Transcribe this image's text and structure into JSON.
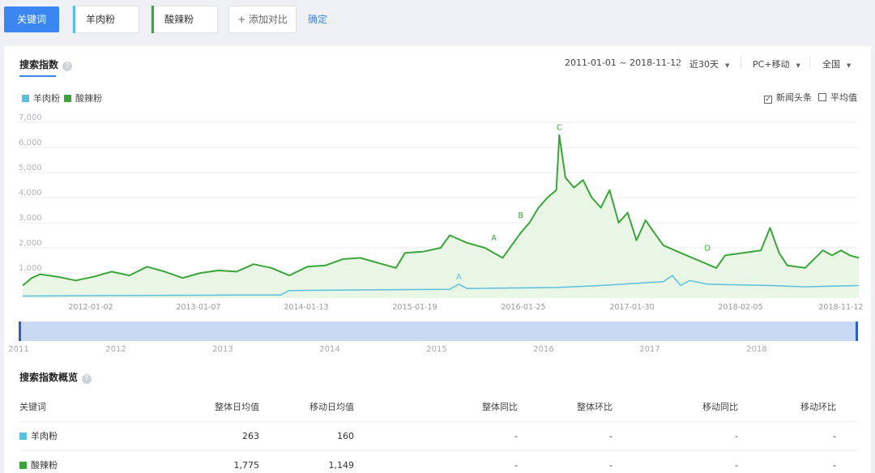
{
  "keywords_bar": {
    "keyword_button": "关键词",
    "chips": [
      {
        "label": "羊肉粉",
        "color": "#5bc0de"
      },
      {
        "label": "酸辣粉",
        "color": "#3aa53a"
      }
    ],
    "add_compare": "+ 添加对比",
    "confirm": "确定"
  },
  "section": {
    "title": "搜索指数",
    "date_range": "2011-01-01 ~ 2018-11-12",
    "period": "近30天",
    "device": "PC+移动",
    "region": "全国"
  },
  "legend": [
    {
      "label": "羊肉粉",
      "color": "#5bc0de"
    },
    {
      "label": "酸辣粉",
      "color": "#3aa53a"
    }
  ],
  "options": {
    "news_label": "新闻头条",
    "news_checked": true,
    "avg_label": "平均值",
    "avg_checked": false
  },
  "chart_data": {
    "type": "line",
    "ylim": [
      0,
      7000
    ],
    "yticks": [
      "7,000",
      "6,000",
      "5,000",
      "4,000",
      "3,000",
      "2,000",
      "1,000"
    ],
    "x_tick_labels": [
      "2012-01-02",
      "2013-01-07",
      "2014-01-13",
      "2015-01-19",
      "2016-01-25",
      "2017-01-30",
      "2018-02-05",
      "2018-11-12"
    ],
    "grid": true,
    "series": [
      {
        "name": "酸辣粉",
        "color": "#3aa53a",
        "points": [
          [
            "2011-01",
            500
          ],
          [
            "2011-02",
            800
          ],
          [
            "2011-03",
            950
          ],
          [
            "2011-05",
            850
          ],
          [
            "2011-07",
            700
          ],
          [
            "2011-09",
            850
          ],
          [
            "2011-11",
            1050
          ],
          [
            "2012-01",
            900
          ],
          [
            "2012-03",
            1250
          ],
          [
            "2012-05",
            1050
          ],
          [
            "2012-07",
            800
          ],
          [
            "2012-09",
            1000
          ],
          [
            "2012-11",
            1100
          ],
          [
            "2013-01",
            1050
          ],
          [
            "2013-03",
            1350
          ],
          [
            "2013-05",
            1200
          ],
          [
            "2013-07",
            900
          ],
          [
            "2013-09",
            1250
          ],
          [
            "2013-11",
            1300
          ],
          [
            "2014-01",
            1550
          ],
          [
            "2014-03",
            1600
          ],
          [
            "2014-05",
            1400
          ],
          [
            "2014-07",
            1200
          ],
          [
            "2014-08",
            1800
          ],
          [
            "2014-10",
            1850
          ],
          [
            "2014-12",
            2000
          ],
          [
            "2015-01",
            2500
          ],
          [
            "2015-03",
            2200
          ],
          [
            "2015-05",
            2000
          ],
          [
            "2015-07",
            1600
          ],
          [
            "2015-08",
            2100
          ],
          [
            "2015-09",
            2600
          ],
          [
            "2015-10",
            3000
          ],
          [
            "2015-11",
            3600
          ],
          [
            "2015-12",
            4000
          ],
          [
            "2016-01",
            4300
          ],
          [
            "2016-01-25",
            6500
          ],
          [
            "2016-02",
            4800
          ],
          [
            "2016-03",
            4400
          ],
          [
            "2016-04",
            4700
          ],
          [
            "2016-05",
            4000
          ],
          [
            "2016-06",
            3600
          ],
          [
            "2016-07",
            4300
          ],
          [
            "2016-08",
            3000
          ],
          [
            "2016-09",
            3400
          ],
          [
            "2016-10",
            2300
          ],
          [
            "2016-11",
            3100
          ],
          [
            "2016-12",
            2600
          ],
          [
            "2017-01",
            2100
          ],
          [
            "2017-03",
            1800
          ],
          [
            "2017-05",
            1500
          ],
          [
            "2017-07",
            1200
          ],
          [
            "2017-08",
            1700
          ],
          [
            "2017-10",
            1800
          ],
          [
            "2017-12",
            1900
          ],
          [
            "2018-01",
            2800
          ],
          [
            "2018-02",
            1800
          ],
          [
            "2018-03",
            1300
          ],
          [
            "2018-05",
            1200
          ],
          [
            "2018-07",
            1900
          ],
          [
            "2018-08",
            1700
          ],
          [
            "2018-09",
            1900
          ],
          [
            "2018-10",
            1700
          ],
          [
            "2018-11",
            1600
          ]
        ]
      },
      {
        "name": "羊肉粉",
        "color": "#5bc0de",
        "points": [
          [
            "2011-01",
            80
          ],
          [
            "2012-01",
            100
          ],
          [
            "2013-01",
            120
          ],
          [
            "2013-06",
            120
          ],
          [
            "2013-07",
            300
          ],
          [
            "2014-01",
            320
          ],
          [
            "2015-01",
            350
          ],
          [
            "2015-02",
            550
          ],
          [
            "2015-03",
            380
          ],
          [
            "2016-01",
            420
          ],
          [
            "2016-06",
            500
          ],
          [
            "2017-01",
            650
          ],
          [
            "2017-02",
            900
          ],
          [
            "2017-03",
            500
          ],
          [
            "2017-04",
            700
          ],
          [
            "2017-06",
            550
          ],
          [
            "2018-01",
            500
          ],
          [
            "2018-05",
            450
          ],
          [
            "2018-11",
            500
          ]
        ]
      }
    ],
    "annotations": [
      {
        "label": "A",
        "series": "酸辣粉",
        "x": "2015-06",
        "y": 2100
      },
      {
        "label": "B",
        "series": "酸辣粉",
        "x": "2015-09",
        "y": 3000
      },
      {
        "label": "C",
        "series": "酸辣粉",
        "x": "2016-01-25",
        "y": 6500
      },
      {
        "label": "D",
        "series": "酸辣粉",
        "x": "2017-06",
        "y": 1700
      },
      {
        "label": "A",
        "series": "羊肉粉",
        "x": "2015-02",
        "y": 550
      }
    ],
    "range_selector_years": [
      "2011",
      "2012",
      "2013",
      "2014",
      "2015",
      "2016",
      "2017",
      "2018"
    ]
  },
  "overview": {
    "title": "搜索指数概览",
    "headers": [
      "关键词",
      "整体日均值",
      "移动日均值",
      "整体同比",
      "整体环比",
      "移动同比",
      "移动环比"
    ],
    "rows": [
      {
        "keyword": "羊肉粉",
        "color": "#5bc0de",
        "values": [
          "263",
          "160",
          "-",
          "-",
          "-",
          "-"
        ]
      },
      {
        "keyword": "酸辣粉",
        "color": "#3aa53a",
        "values": [
          "1,775",
          "1,149",
          "-",
          "-",
          "-",
          "-"
        ]
      }
    ]
  }
}
